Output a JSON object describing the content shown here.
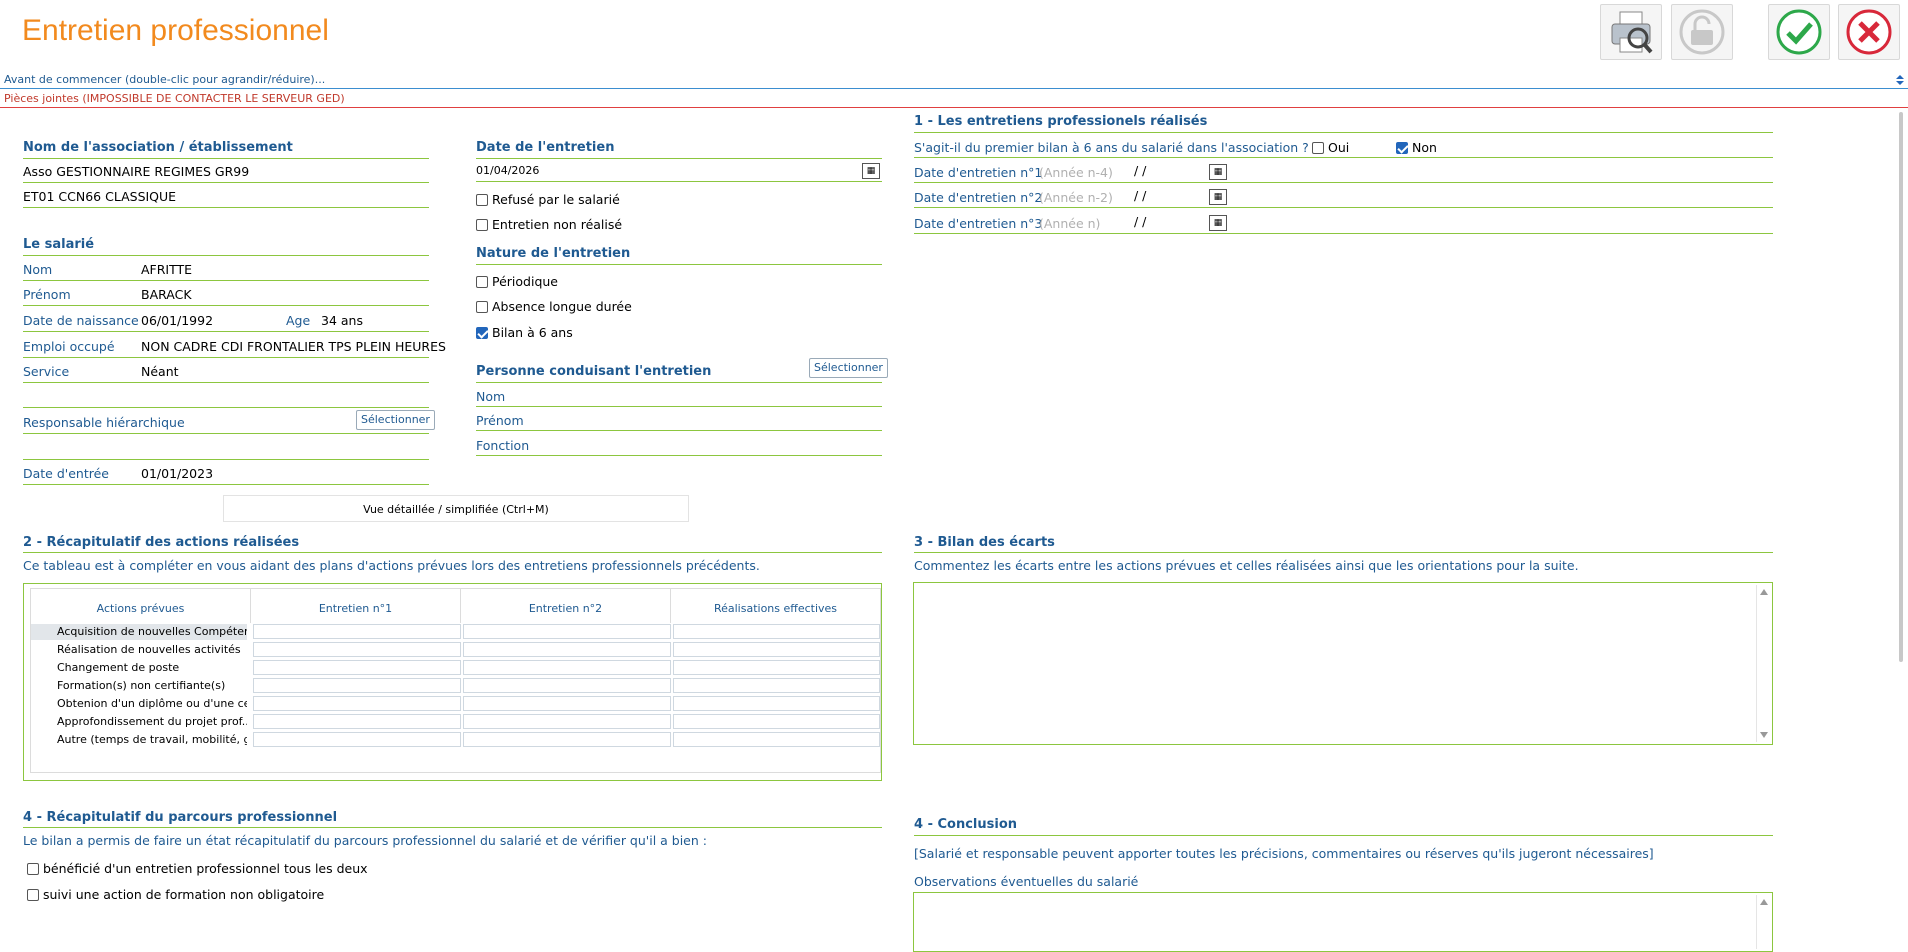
{
  "header": {
    "title": "Entretien professionnel"
  },
  "bars": {
    "before": "Avant de commencer (double-clic pour agrandir/réduire)...",
    "attachments": "Pièces jointes (IMPOSSIBLE DE CONTACTER LE SERVEUR GED)"
  },
  "assoc": {
    "heading": "Nom de l'association / établissement",
    "name": "Asso GESTIONNAIRE REGIMES GR99",
    "etab": "ET01 CCN66 CLASSIQUE"
  },
  "salarie": {
    "heading": "Le salarié",
    "nom_label": "Nom",
    "nom": "AFRITTE",
    "prenom_label": "Prénom",
    "prenom": "BARACK",
    "naissance_label": "Date de naissance",
    "naissance": "06/01/1992",
    "age_label": "Age",
    "age": "34 ans",
    "emploi_label": "Emploi occupé",
    "emploi": "NON CADRE CDI FRONTALIER TPS PLEIN HEURES",
    "service_label": "Service",
    "service": "Néant",
    "responsable_label": "Responsable hiérarchique",
    "entree_label": "Date d'entrée",
    "entree": "01/01/2023",
    "select_btn": "Sélectionner"
  },
  "entretien": {
    "date_heading": "Date de l'entretien",
    "date": "01/04/2026",
    "refuse": "Refusé par le salarié",
    "non_realise": "Entretien non réalisé",
    "nature_heading": "Nature de l'entretien",
    "periodique": "Périodique",
    "absence": "Absence longue durée",
    "bilan": "Bilan à 6 ans",
    "personne_heading": "Personne conduisant l'entretien",
    "select_btn": "Sélectionner",
    "nom": "Nom",
    "prenom": "Prénom",
    "fonction": "Fonction"
  },
  "vue_btn": "Vue détaillée / simplifiée (Ctrl+M)",
  "s1": {
    "heading": "1 - Les entretiens professionels réalisés",
    "question": "S'agit-il du premier bilan à 6 ans du salarié dans l'association ?",
    "oui": "Oui",
    "non": "Non",
    "rows": [
      {
        "label": "Date d'entretien n°1",
        "hint": "(Année n-4)",
        "value": "/ /"
      },
      {
        "label": "Date d'entretien n°2",
        "hint": "(Année n-2)",
        "value": "/ /"
      },
      {
        "label": "Date d'entretien n°3",
        "hint": "(Année n)",
        "value": "/ /"
      }
    ]
  },
  "s2": {
    "heading": "2 - Récapitulatif des actions réalisées",
    "desc": "Ce tableau est à compléter en vous aidant des plans d'actions prévues lors des entretiens professionnels précédents.",
    "columns": [
      "Actions prévues",
      "Entretien n°1",
      "Entretien n°2",
      "Réalisations effectives"
    ],
    "rows": [
      "Acquisition de nouvelles Compétences",
      "Réalisation de nouvelles activités",
      "Changement de poste",
      "Formation(s) non certifiante(s)",
      "Obtenion d'un diplôme ou d'une certif...",
      "Approfondissement du projet prof...",
      "Autre (temps de travail, mobilité, gé..."
    ]
  },
  "s3": {
    "heading": "3 - Bilan des écarts",
    "desc": "Commentez les écarts entre les actions prévues et celles réalisées ainsi que les orientations pour la suite."
  },
  "s4a": {
    "heading": "4 - Récapitulatif du parcours professionnel",
    "desc": "Le bilan a permis de faire un état récapitulatif du parcours professionnel du salarié et de vérifier qu'il a bien :",
    "opt1": "bénéficié d'un entretien professionnel tous les deux",
    "opt2": "suivi une action de formation non obligatoire"
  },
  "s4b": {
    "heading": "4 - Conclusion",
    "desc": "[Salarié et responsable peuvent apporter toutes les précisions, commentaires ou réserves qu'ils jugeront nécessaires]",
    "obs": "Observations éventuelles du salarié"
  },
  "colors": {
    "accent": "#f28a1e",
    "label": "#1f5a91",
    "line": "#8cc63f"
  }
}
